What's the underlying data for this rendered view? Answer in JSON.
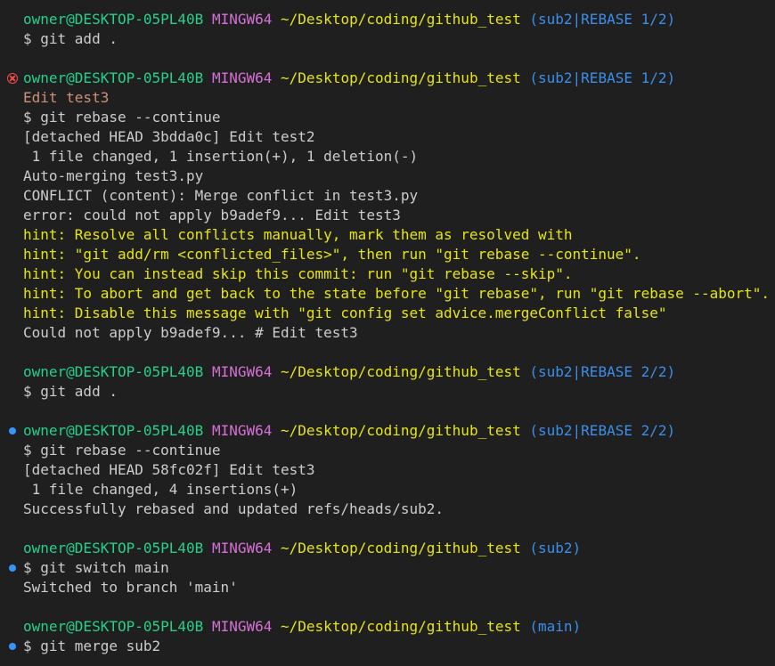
{
  "lines": [
    {
      "kind": "prompt",
      "user": "owner@DESKTOP-05PL40B",
      "sys": "MINGW64",
      "path": "~/Desktop/coding/github_test",
      "branch": "(sub2|REBASE 1/2)",
      "marker": ""
    },
    {
      "kind": "cmd",
      "text": "$ git add .",
      "marker": ""
    },
    {
      "kind": "blank"
    },
    {
      "kind": "prompt",
      "user": "owner@DESKTOP-05PL40B",
      "sys": "MINGW64",
      "path": "~/Desktop/coding/github_test",
      "branch": "(sub2|REBASE 1/2)",
      "marker": "error"
    },
    {
      "kind": "out",
      "text": "Edit test3",
      "color": "orange"
    },
    {
      "kind": "cmd",
      "text": "$ git rebase --continue",
      "marker": ""
    },
    {
      "kind": "out",
      "text": "[detached HEAD 3bdda0c] Edit test2"
    },
    {
      "kind": "out",
      "text": " 1 file changed, 1 insertion(+), 1 deletion(-)"
    },
    {
      "kind": "out",
      "text": "Auto-merging test3.py"
    },
    {
      "kind": "out",
      "text": "CONFLICT (content): Merge conflict in test3.py"
    },
    {
      "kind": "out",
      "text": "error: could not apply b9adef9... Edit test3"
    },
    {
      "kind": "out",
      "text": "hint: Resolve all conflicts manually, mark them as resolved with",
      "color": "yellow"
    },
    {
      "kind": "out",
      "text": "hint: \"git add/rm <conflicted_files>\", then run \"git rebase --continue\".",
      "color": "yellow"
    },
    {
      "kind": "out",
      "text": "hint: You can instead skip this commit: run \"git rebase --skip\".",
      "color": "yellow"
    },
    {
      "kind": "out",
      "text": "hint: To abort and get back to the state before \"git rebase\", run \"git rebase --abort\".",
      "color": "yellow"
    },
    {
      "kind": "out",
      "text": "hint: Disable this message with \"git config set advice.mergeConflict false\"",
      "color": "yellow"
    },
    {
      "kind": "out",
      "text": "Could not apply b9adef9... # Edit test3"
    },
    {
      "kind": "blank"
    },
    {
      "kind": "prompt",
      "user": "owner@DESKTOP-05PL40B",
      "sys": "MINGW64",
      "path": "~/Desktop/coding/github_test",
      "branch": "(sub2|REBASE 2/2)",
      "marker": ""
    },
    {
      "kind": "cmd",
      "text": "$ git add .",
      "marker": ""
    },
    {
      "kind": "blank"
    },
    {
      "kind": "prompt",
      "user": "owner@DESKTOP-05PL40B",
      "sys": "MINGW64",
      "path": "~/Desktop/coding/github_test",
      "branch": "(sub2|REBASE 2/2)",
      "marker": "success"
    },
    {
      "kind": "cmd",
      "text": "$ git rebase --continue",
      "marker": ""
    },
    {
      "kind": "out",
      "text": "[detached HEAD 58fc02f] Edit test3"
    },
    {
      "kind": "out",
      "text": " 1 file changed, 4 insertions(+)"
    },
    {
      "kind": "out",
      "text": "Successfully rebased and updated refs/heads/sub2."
    },
    {
      "kind": "blank"
    },
    {
      "kind": "prompt",
      "user": "owner@DESKTOP-05PL40B",
      "sys": "MINGW64",
      "path": "~/Desktop/coding/github_test",
      "branch": "(sub2)",
      "marker": ""
    },
    {
      "kind": "cmd",
      "text": "$ git switch main",
      "marker": "success"
    },
    {
      "kind": "out",
      "text": "Switched to branch 'main'"
    },
    {
      "kind": "blank"
    },
    {
      "kind": "prompt",
      "user": "owner@DESKTOP-05PL40B",
      "sys": "MINGW64",
      "path": "~/Desktop/coding/github_test",
      "branch": "(main)",
      "marker": ""
    },
    {
      "kind": "cmd",
      "text": "$ git merge sub2",
      "marker": "success"
    }
  ],
  "colors": {
    "background": "#1f1f1f",
    "user": "#23d18b",
    "system": "#d670d6",
    "path": "#e5e510",
    "branch": "#3b8eea",
    "hint": "#e5e510",
    "text": "#cccccc",
    "decoration_success": "#3794ff",
    "decoration_error": "#f14c4c"
  },
  "icons": {
    "error": "error-decoration-icon",
    "success": "success-decoration-icon"
  }
}
